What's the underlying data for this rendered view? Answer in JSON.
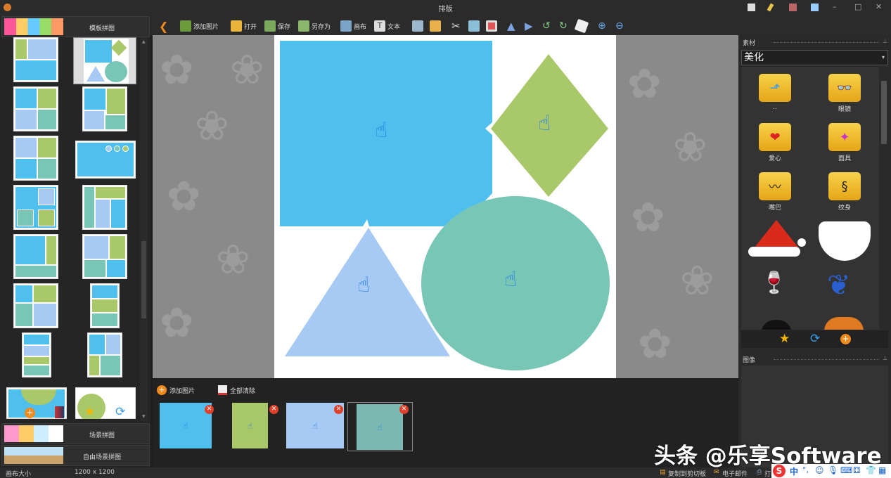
{
  "window": {
    "title": "排版"
  },
  "left_panel": {
    "template_tab": "模板拼图",
    "scene_tab": "场景拼图",
    "free_scene_tab": "自由场景拼图"
  },
  "toolbar": {
    "add_image": "添加图片",
    "open": "打开",
    "save": "保存",
    "save_as": "另存为",
    "canvas": "画布",
    "text": "文本"
  },
  "filmstrip": {
    "add_image": "添加图片",
    "clear_all": "全部清除",
    "items": [
      {
        "color": "#4fb8ec"
      },
      {
        "color": "#a8c86a"
      },
      {
        "color": "#a6c9f3"
      },
      {
        "color": "#7bb9b2"
      }
    ]
  },
  "right_panel": {
    "materials_title": "素材",
    "category": "美化",
    "items": [
      {
        "label": ".."
      },
      {
        "label": "眼镜"
      },
      {
        "label": "爱心"
      },
      {
        "label": "面具"
      },
      {
        "label": "嘴巴"
      },
      {
        "label": "纹身"
      }
    ],
    "image_title": "图像"
  },
  "status": {
    "canvas_size_label": "画布大小",
    "canvas_size_value": "1200 x 1200",
    "copy_clipboard": "复制到剪切板",
    "email": "电子邮件",
    "print": "打印"
  },
  "watermark": "头条 @乐享Software",
  "colors": {
    "blue": "#4fbfee",
    "green": "#a9c86a",
    "light_blue": "#a6caf3",
    "teal": "#78c6b6",
    "hand": "#1e7be0"
  }
}
